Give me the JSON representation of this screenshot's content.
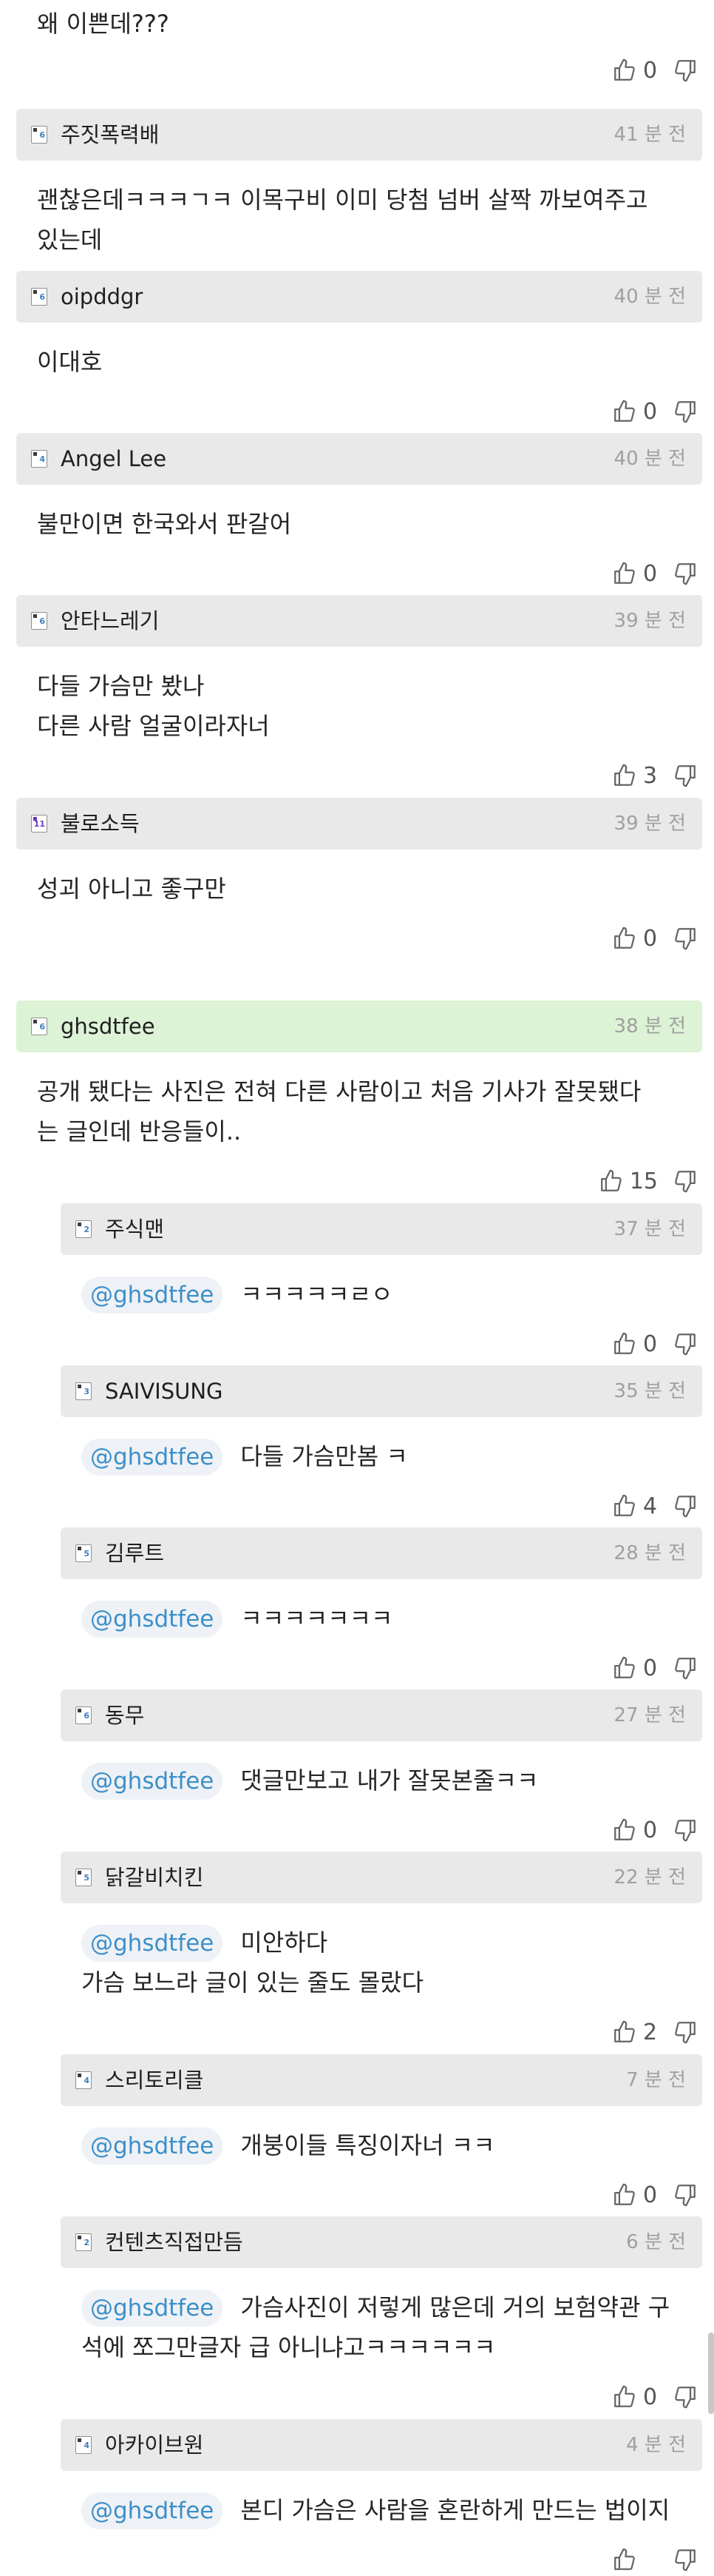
{
  "top_comment": {
    "text": "왜 이쁜데???",
    "likes": "0"
  },
  "comments": [
    {
      "level": "6",
      "level_color": "blue",
      "user": "주짓폭력배",
      "time": "41 분 전",
      "lines": [
        "괜찮은데ㅋㅋㅋㄱㅋ 이목구비 이미 당첨 넘버 살짝 까보여주고",
        "있는데"
      ],
      "likes": "0"
    },
    {
      "level": "6",
      "level_color": "blue",
      "user": "oipddgr",
      "time": "40 분 전",
      "lines": [
        "이대호"
      ],
      "likes": "0"
    },
    {
      "level": "4",
      "level_color": "blue",
      "user": "Angel Lee",
      "time": "40 분 전",
      "lines": [
        "불만이면 한국와서 판갈어"
      ],
      "likes": "0"
    },
    {
      "level": "6",
      "level_color": "blue",
      "user": "안타느레기",
      "time": "39 분 전",
      "lines": [
        "다들 가슴만 봤나",
        "다른 사람 얼굴이라자너"
      ],
      "likes": "3"
    },
    {
      "level": "11",
      "level_color": "purple",
      "user": "불로소득",
      "time": "39 분 전",
      "lines": [
        "성괴 아니고 좋구만"
      ],
      "likes": "0"
    },
    {
      "level": "6",
      "level_color": "blue",
      "user": "ghsdtfee",
      "time": "38 분 전",
      "highlight": true,
      "lines": [
        "공개 됐다는 사진은 전혀 다른 사람이고 처음 기사가 잘못됐다",
        "는 글인데 반응들이.."
      ],
      "likes": "15"
    }
  ],
  "replies": [
    {
      "level": "2",
      "user": "주식맨",
      "time": "37 분 전",
      "mention": "@ghsdtfee",
      "lines": [
        "ㅋㅋㅋㅋㅋㄹㅇ"
      ],
      "likes": "0"
    },
    {
      "level": "3",
      "user": "SAIVISUNG",
      "time": "35 분 전",
      "mention": "@ghsdtfee",
      "lines": [
        "다들 가슴만봄 ㅋ"
      ],
      "likes": "4"
    },
    {
      "level": "5",
      "user": "김루트",
      "time": "28 분 전",
      "mention": "@ghsdtfee",
      "lines": [
        "ㅋㅋㅋㅋㅋㅋㅋ"
      ],
      "likes": "0"
    },
    {
      "level": "6",
      "user": "동무",
      "time": "27 분 전",
      "mention": "@ghsdtfee",
      "lines": [
        "댓글만보고 내가 잘못본줄ㅋㅋ"
      ],
      "likes": "0"
    },
    {
      "level": "5",
      "user": "닭갈비치킨",
      "time": "22 분 전",
      "mention": "@ghsdtfee",
      "lines": [
        "미안하다",
        "가슴 보느라 글이 있는 줄도 몰랐다"
      ],
      "likes": "2"
    },
    {
      "level": "4",
      "user": "스리토리클",
      "time": "7 분 전",
      "mention": "@ghsdtfee",
      "lines": [
        "개붕이들 특징이자너 ㅋㅋ"
      ],
      "likes": "0"
    },
    {
      "level": "2",
      "user": "컨텐츠직접만듬",
      "time": "6 분 전",
      "mention": "@ghsdtfee",
      "lines": [
        "가슴사진이 저렇게 많은데 거의 보험약관 구",
        "석에 쪼그만글자 급 아니냐고ㅋㅋㅋㅋㅋㅋ"
      ],
      "likes": "0"
    },
    {
      "level": "4",
      "user": "아카이브원",
      "time": "4 분 전",
      "mention": "@ghsdtfee",
      "lines": [
        "본디 가슴은 사람을 혼란하게 만드는 법이지"
      ],
      "likes": ""
    }
  ],
  "colors": {
    "header_bg": "#e9e9e9",
    "highlight_bg": "#dcf3d5",
    "mention_text": "#3d8fc9",
    "mention_bg": "#eef2f6",
    "level_blue": "#3d7fc4",
    "level_purple": "#6e37c7"
  },
  "icons": {
    "like": "thumbs-up-icon",
    "dislike": "thumbs-down-icon"
  }
}
